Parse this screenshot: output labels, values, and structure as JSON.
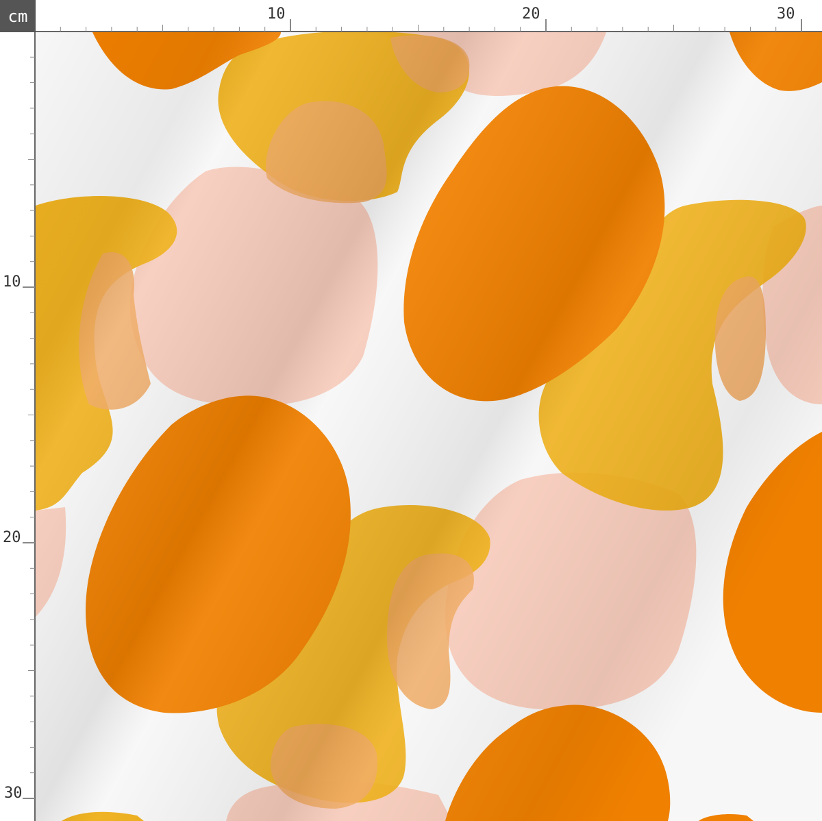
{
  "ruler": {
    "unit": "cm",
    "top_labels": [
      "10",
      "20",
      "30"
    ],
    "left_labels": [
      "10",
      "20",
      "30"
    ]
  },
  "pattern": {
    "description_colors": {
      "background": "#f7f7f7",
      "orange": "#f08000",
      "mustard": "#eeae15",
      "pink": "#f7ccbc",
      "peach_overlap": "#efa75e"
    }
  }
}
